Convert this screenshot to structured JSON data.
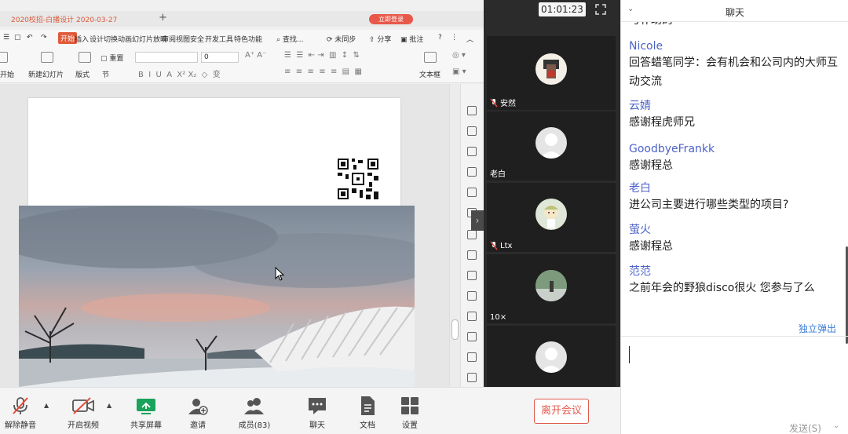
{
  "meeting": {
    "timer": "01:01:23"
  },
  "wps": {
    "doc_tab_title": "2020校招-白播设计 2020-03-27",
    "login_badge": "立即登录",
    "menu": [
      "开始",
      "插入",
      "设计",
      "切换",
      "动画",
      "幻灯片放映",
      "审阅",
      "视图",
      "安全",
      "开发工具",
      "特色功能"
    ],
    "search": "查找...",
    "sync": "未同步",
    "share": "分享",
    "review": "批注",
    "ribbon": {
      "start": "开始",
      "new_slide": "新建幻灯片",
      "layout": "版式",
      "section": "节",
      "reset": "重置",
      "font_size": "0",
      "textbox": "文本框"
    }
  },
  "strip": {
    "tiles": [
      {
        "name": "安然",
        "avatar": "photo"
      },
      {
        "name": "老白",
        "avatar": "default"
      },
      {
        "name": "Ltx",
        "avatar": "cartoon"
      },
      {
        "name": "10×",
        "avatar": "photo"
      },
      {
        "name": "",
        "avatar": "default"
      }
    ]
  },
  "toolbar": {
    "unmute": "解除静音",
    "start_video": "开启视频",
    "share_screen": "共享屏幕",
    "invite": "邀请",
    "members": "成员(83)",
    "chat": "聊天",
    "docs": "文档",
    "settings": "设置",
    "leave": "离开会议"
  },
  "chat": {
    "title": "聊天",
    "top_cut_text": "与补助的",
    "messages": [
      {
        "sender": "Nicole",
        "text": "回答蜡笔同学：会有机会和公司内的大师互动交流"
      },
      {
        "sender": "云婧",
        "text": "感谢程虎师兄"
      },
      {
        "sender": "GoodbyeFrankk",
        "text": "感谢程总"
      },
      {
        "sender": "老白",
        "text": "进公司主要进行哪些类型的项目?"
      },
      {
        "sender": "萤火",
        "text": "感谢程总"
      },
      {
        "sender": "范范",
        "text": "之前年会的野狼disco很火  您参与了么"
      }
    ],
    "popout": "独立弹出",
    "send": "发送(S)"
  },
  "colors": {
    "accent_red": "#e05a4e",
    "sender_blue": "#4d63c9",
    "share_green": "#1aa35a"
  }
}
